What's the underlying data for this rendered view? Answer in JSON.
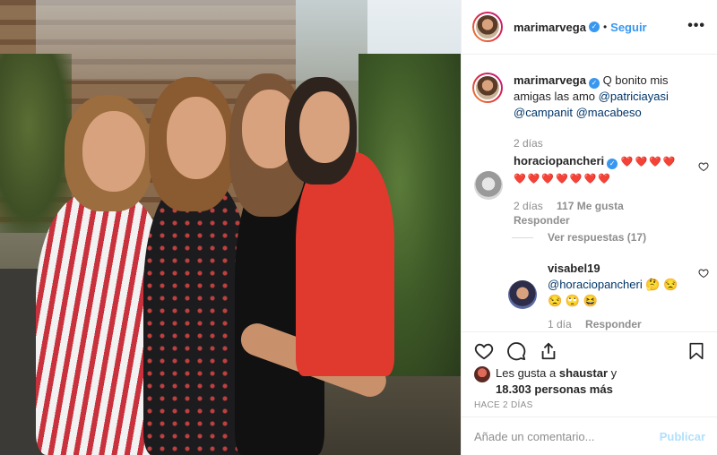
{
  "post": {
    "username": "marimarvega",
    "follow_label": "Seguir",
    "separator": "•",
    "more_icon": "more-icon"
  },
  "caption": {
    "username": "marimarvega",
    "text": "Q bonito mis amigas las amo",
    "mentions": [
      "@patriciayasi",
      "@campanit",
      "@macabeso"
    ],
    "time": "2 días"
  },
  "comments": [
    {
      "username": "horaciopancheri",
      "verified": true,
      "hearts": "❤️❤️❤️❤️❤️❤️❤️❤️❤️❤️❤️",
      "time": "2 días",
      "likes": "117 Me gusta",
      "reply_label": "Responder",
      "view_replies": "Ver respuestas (17)"
    },
    {
      "username": "visabel19",
      "mention": "@horaciopancheri",
      "emojis": "🤔 😒 😒 🙄 😆",
      "time": "1 día",
      "reply_label": "Responder"
    }
  ],
  "likes": {
    "prefix": "Les gusta a",
    "user": "shaustar",
    "middle": "y",
    "count": "18.303 personas más"
  },
  "timestamp": "HACE 2 DÍAS",
  "add_comment": {
    "placeholder": "Añade un comentario...",
    "publish_label": "Publicar"
  },
  "colors": {
    "accent": "#3897f0",
    "heart": "#e0245e",
    "publish_disabled": "#b2dffc",
    "muted": "#8e8e8e"
  }
}
